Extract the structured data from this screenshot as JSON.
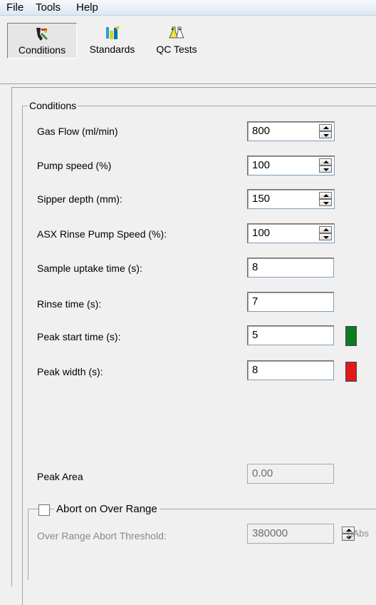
{
  "menu": {
    "items": [
      "File",
      "Tools",
      "Help"
    ]
  },
  "toolbar": {
    "buttons": [
      {
        "label": "Conditions",
        "icon": "conditions-icon"
      },
      {
        "label": "Standards",
        "icon": "standards-icon"
      },
      {
        "label": "QC Tests",
        "icon": "qc-tests-icon"
      }
    ]
  },
  "conditions": {
    "title": "Conditions",
    "gas_flow": {
      "label": "Gas Flow (ml/min)",
      "value": "800"
    },
    "pump_speed": {
      "label": "Pump speed (%)",
      "value": "100"
    },
    "sipper_depth": {
      "label": "Sipper depth (mm):",
      "value": "150"
    },
    "asx_rinse": {
      "label": "ASX Rinse Pump Speed (%):",
      "value": "100"
    },
    "sample_uptake": {
      "label": "Sample uptake time (s):",
      "value": "8"
    },
    "rinse_time": {
      "label": "Rinse time (s):",
      "value": "7"
    },
    "peak_start": {
      "label": "Peak start time (s):",
      "value": "5",
      "color": "#0f7a1e"
    },
    "peak_width": {
      "label": "Peak width (s):",
      "value": "8",
      "color": "#e01b1b"
    },
    "peak_area": {
      "label": "Peak Area",
      "value": "0.00"
    }
  },
  "abort": {
    "checkbox_label": "Abort on Over Range",
    "checked": false,
    "threshold_label": "Over Range Abort Threshold:",
    "threshold_value": "380000",
    "unit": "µAbs"
  }
}
